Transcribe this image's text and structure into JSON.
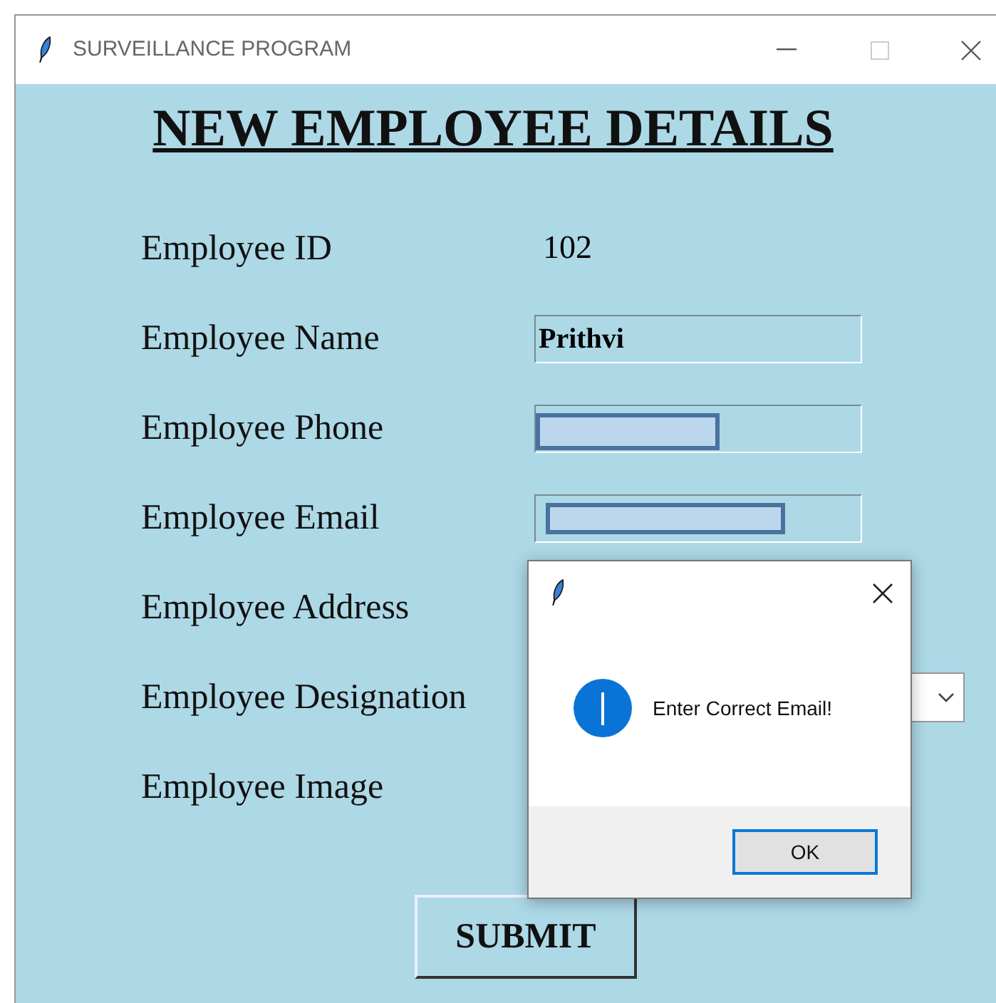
{
  "window": {
    "title": "SURVEILLANCE PROGRAM"
  },
  "heading": "NEW EMPLOYEE DETAILS",
  "fields": [
    {
      "label": "Employee ID",
      "kind": "text",
      "value": "102"
    },
    {
      "label": "Employee Name",
      "kind": "entry",
      "value": "Prithvi"
    },
    {
      "label": "Employee Phone",
      "kind": "entry",
      "redacted": true
    },
    {
      "label": "Employee Email",
      "kind": "entry",
      "redacted": true
    },
    {
      "label": "Employee Address",
      "kind": "label"
    },
    {
      "label": "Employee Designation",
      "kind": "combo"
    },
    {
      "label": "Employee Image",
      "kind": "label"
    }
  ],
  "submit": "SUBMIT",
  "dialog": {
    "message": "Enter Correct Email!",
    "button": "OK"
  }
}
